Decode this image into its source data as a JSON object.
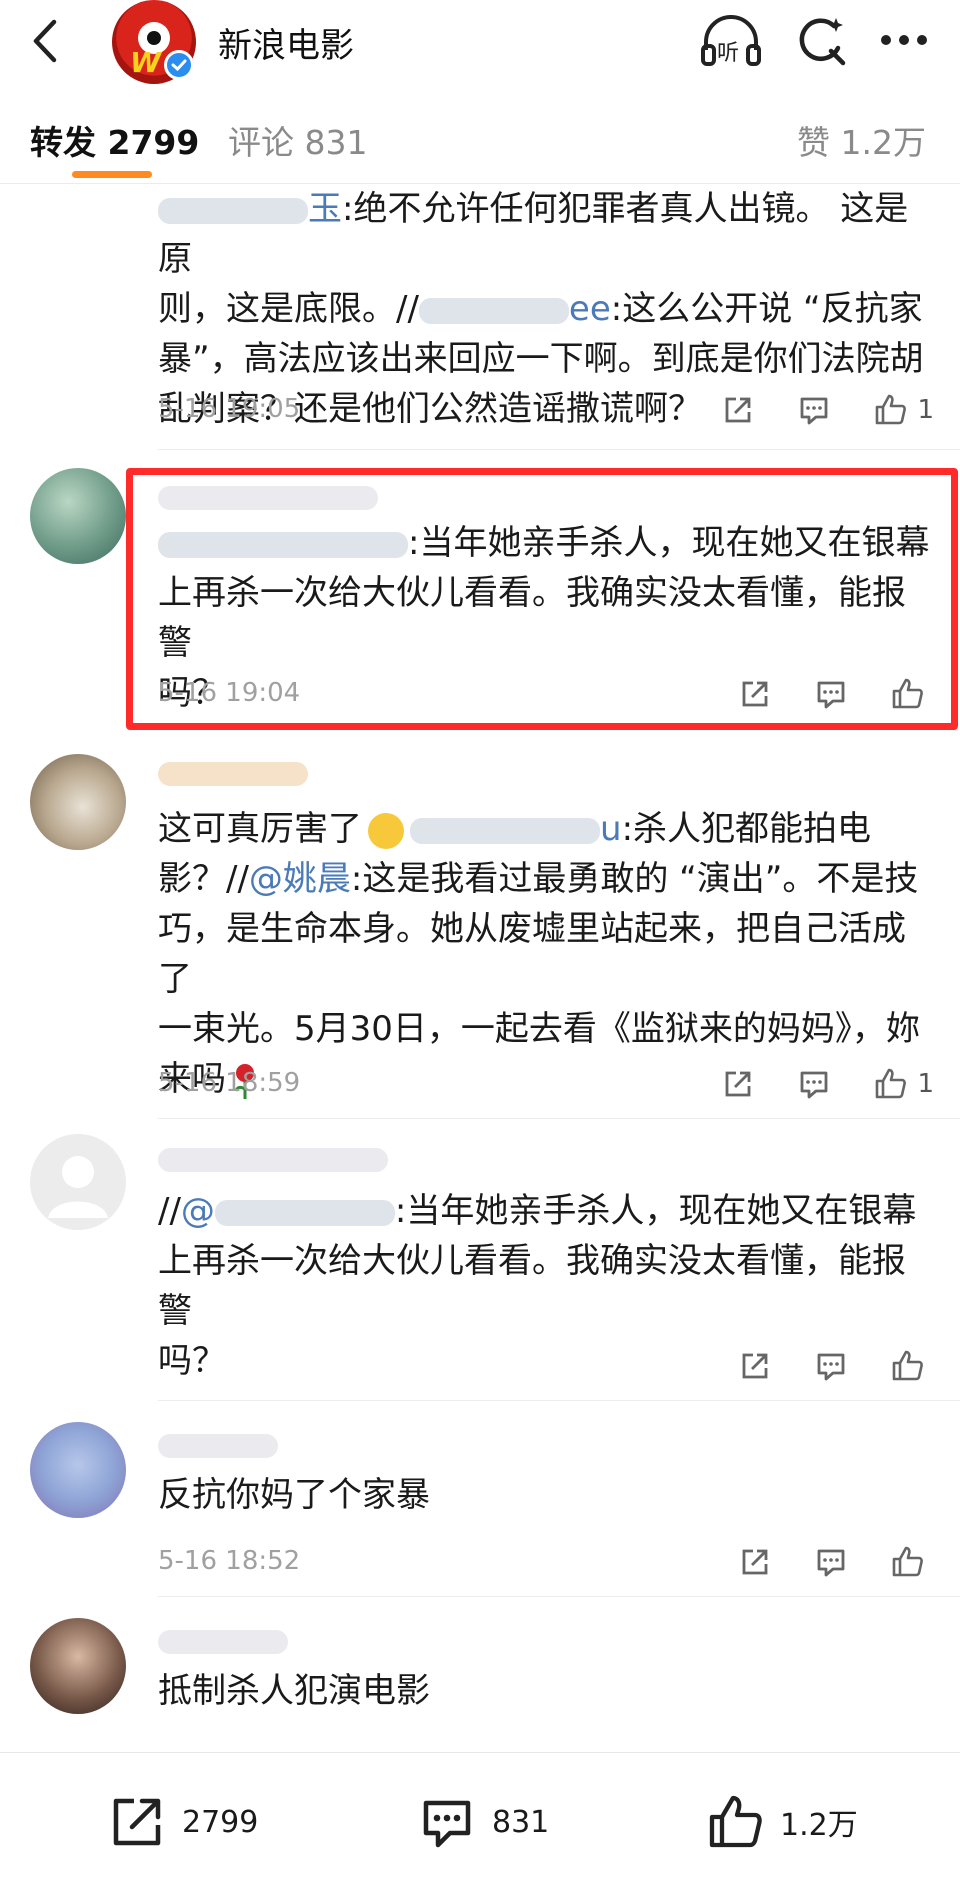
{
  "header": {
    "title": "新浪电影",
    "listen_label": "听"
  },
  "tabs": {
    "repost_label": "转发",
    "repost_count": "2799",
    "comment_label": "评论",
    "comment_count": "831",
    "like_label": "赞",
    "like_count": "1.2万"
  },
  "comments": [
    {
      "mention_suffix": "玉",
      "text_1": ":绝不允许任何犯罪者真人出镜。 这是原",
      "text_2": "则，这是底限。//",
      "mention_2": "ee",
      "text_3": ":这么公开说 “反抗家",
      "text_4": "暴”，高法应该出来回应一下啊。到底是你们法院胡",
      "text_5": "乱判案？还是他们公然造谣撒谎啊？",
      "time": "5-16 19:05",
      "like_count": "1"
    },
    {
      "text_1": ":当年她亲手杀人，现在她又在银幕",
      "text_2": "上再杀一次给大伙儿看看。我确实没太看懂，能报警",
      "text_3": "吗？",
      "time": "5-16 19:04",
      "like_count": ""
    },
    {
      "text_1": "这可真厉害了",
      "mention_1": "u",
      "text_2": ":杀人犯都能拍电",
      "text_3": "影？//",
      "mention_2": "@姚晨",
      "text_4": ":这是我看过最勇敢的 “演出”。不是技",
      "text_5": "巧，是生命本身。她从废墟里站起来，把自己活成了",
      "text_6": "一束光。5月30日，一起去看《监狱来的妈妈》，妳",
      "text_7": "来吗",
      "time": "5-16 18:59",
      "like_count": "1"
    },
    {
      "text_1a": "//",
      "mention_1": "@",
      "text_1": ":当年她亲手杀人，现在她又在银幕",
      "text_2": "上再杀一次给大伙儿看看。我确实没太看懂，能报警",
      "text_3": "吗？",
      "time": "",
      "like_count": ""
    },
    {
      "text_1": "反抗你妈了个家暴",
      "time": "5-16 18:52",
      "like_count": ""
    },
    {
      "text_1": "抵制杀人犯演电影",
      "time": "",
      "like_count": ""
    }
  ],
  "bottom": {
    "repost_count": "2799",
    "comment_count": "831",
    "like_count": "1.2万"
  }
}
